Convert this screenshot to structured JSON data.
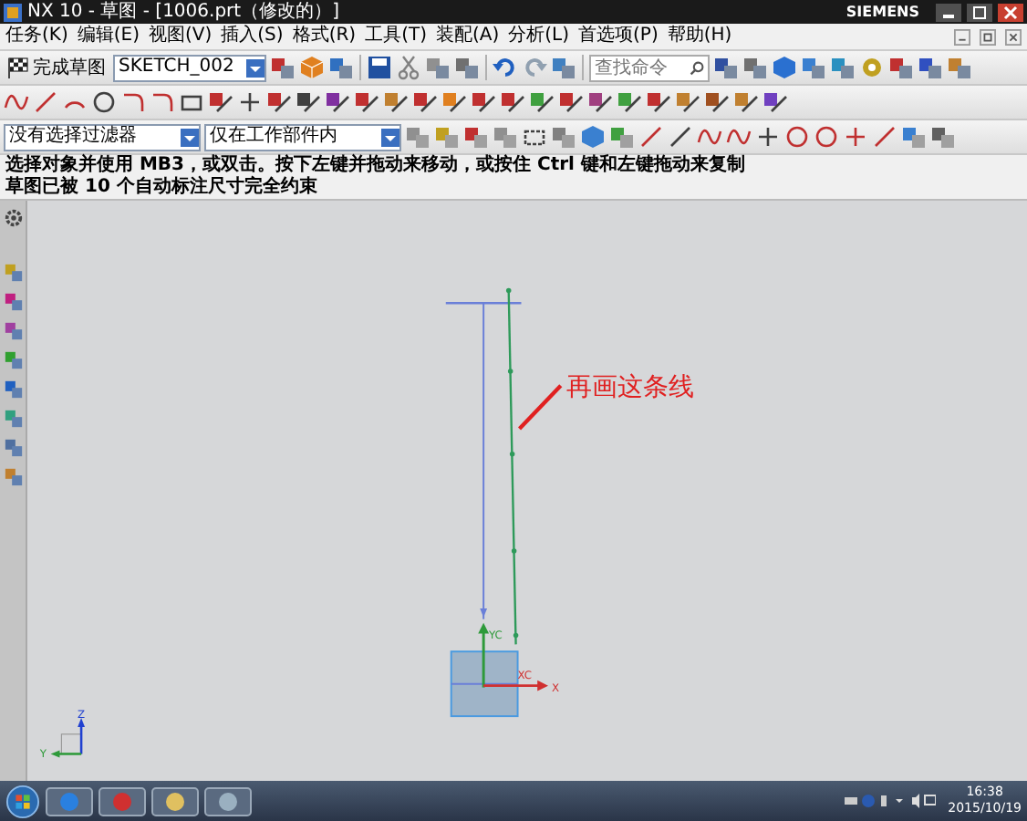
{
  "window": {
    "title": "NX 10 - 草图 - [1006.prt（修改的）]",
    "brand": "SIEMENS"
  },
  "menu": [
    "任务(K)",
    "编辑(E)",
    "视图(V)",
    "插入(S)",
    "格式(R)",
    "工具(T)",
    "装配(A)",
    "分析(L)",
    "首选项(P)",
    "帮助(H)"
  ],
  "toolbar": {
    "finish_sketch": "完成草图",
    "sketch_name": "SKETCH_002",
    "search": {
      "placeholder": "查找命令"
    }
  },
  "filters": [
    "没有选择过滤器",
    "仅在工作部件内"
  ],
  "status": {
    "prompt": "选择对象并使用 MB3，或双击。按下左键并拖动来移动，或按住 Ctrl 键和左键拖动来复制",
    "info": "草图已被 10 个自动标注尺寸完全约束"
  },
  "canvas": {
    "annotation": "再画这条线",
    "labels": {
      "yc": "YC",
      "xc": "XC",
      "x": "X",
      "z": "Z",
      "y": "Y"
    }
  },
  "taskbar": {
    "time": "16:38",
    "date": "2015/10/19"
  }
}
